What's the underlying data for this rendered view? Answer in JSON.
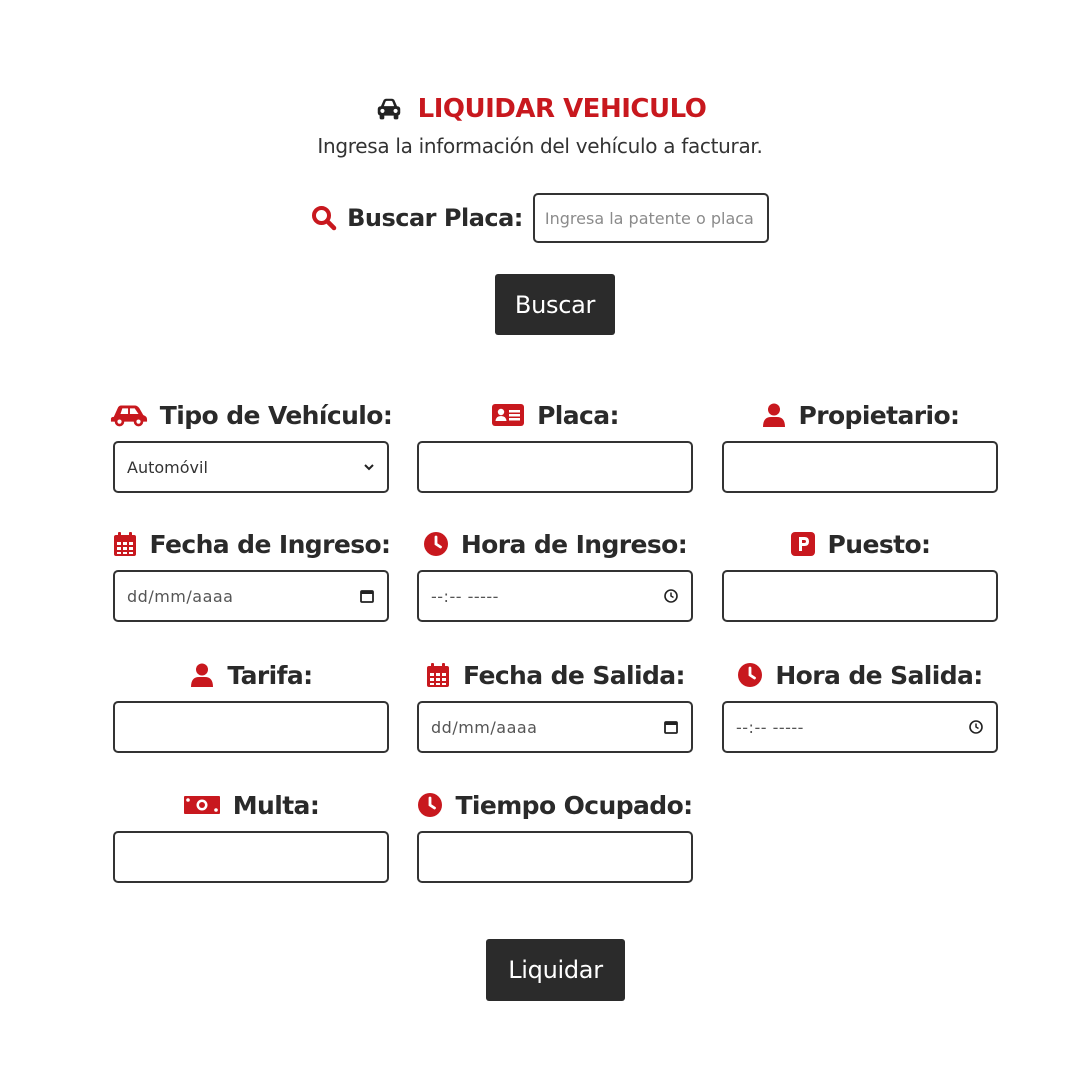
{
  "header": {
    "title": "LIQUIDAR VEHICULO",
    "subtitle": "Ingresa la información del vehículo a facturar.",
    "title_icon": "car-front-icon"
  },
  "search": {
    "label": "Buscar Placa:",
    "placeholder": "Ingresa la patente o placa",
    "value": "",
    "button_label": "Buscar",
    "icon": "search-icon"
  },
  "fields": {
    "tipo_vehiculo": {
      "label": "Tipo de Vehículo:",
      "value": "Automóvil",
      "icon": "car-icon"
    },
    "placa": {
      "label": "Placa:",
      "value": "",
      "icon": "id-card-icon"
    },
    "propietario": {
      "label": "Propietario:",
      "value": "",
      "icon": "user-icon"
    },
    "fecha_ingreso": {
      "label": "Fecha de Ingreso:",
      "value": "dd/mm/aaaa",
      "icon": "calendar-icon"
    },
    "hora_ingreso": {
      "label": "Hora de Ingreso:",
      "value": "--:-- -----",
      "icon": "clock-icon"
    },
    "puesto": {
      "label": "Puesto:",
      "value": "",
      "icon": "parking-icon"
    },
    "tarifa": {
      "label": "Tarifa:",
      "value": "",
      "icon": "user-icon"
    },
    "fecha_salida": {
      "label": "Fecha de Salida:",
      "value": "dd/mm/aaaa",
      "icon": "calendar-icon"
    },
    "hora_salida": {
      "label": "Hora de Salida:",
      "value": "--:-- -----",
      "icon": "clock-icon"
    },
    "multa": {
      "label": "Multa:",
      "value": "",
      "icon": "money-bill-icon"
    },
    "tiempo_ocupado": {
      "label": "Tiempo Ocupado:",
      "value": "",
      "icon": "clock-icon"
    }
  },
  "actions": {
    "submit_label": "Liquidar"
  },
  "colors": {
    "accent": "#c8181e",
    "button_bg": "#2b2b2b",
    "text": "#2a2a2a"
  }
}
